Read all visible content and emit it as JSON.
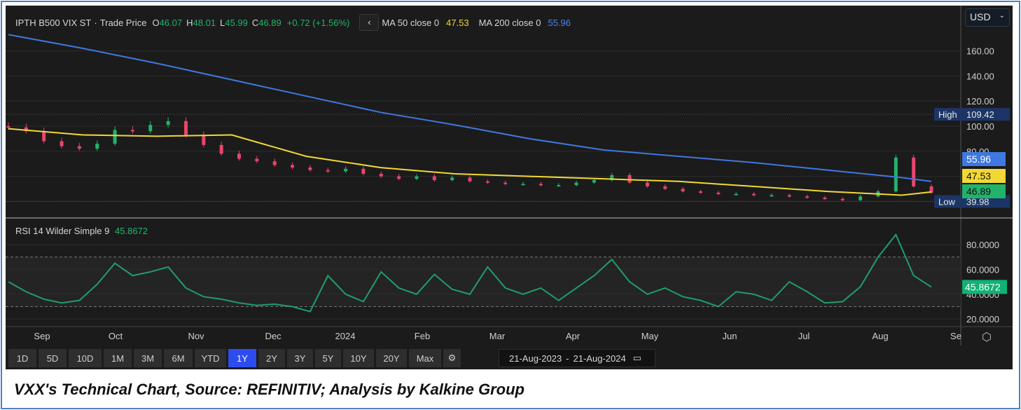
{
  "header": {
    "symbol": "IPTH B500 VIX ST",
    "separator": "·",
    "price_type": "Trade Price",
    "o_label": "O",
    "open": "46.07",
    "h_label": "H",
    "high": "48.01",
    "l_label": "L",
    "low": "45.99",
    "c_label": "C",
    "close": "46.89",
    "change": "+0.72 (+1.56%)",
    "back_icon": "chevron-left-icon",
    "ma50_label": "MA 50 close 0",
    "ma50_value": "47.53",
    "ma200_label": "MA 200 close 0",
    "ma200_value": "55.96"
  },
  "currency": {
    "selected": "USD"
  },
  "rsi_header": {
    "label": "RSI 14 Wilder Simple 9",
    "value": "45.8672"
  },
  "toolbar": {
    "buttons": [
      "1D",
      "5D",
      "10D",
      "1M",
      "3M",
      "6M",
      "YTD",
      "1Y",
      "2Y",
      "3Y",
      "5Y",
      "10Y",
      "20Y",
      "Max"
    ],
    "active": "1Y",
    "settings_icon": "gear-icon",
    "date_from": "21-Aug-2023",
    "date_sep": "-",
    "date_to": "21-Aug-2024",
    "calendar_icon": "calendar-icon"
  },
  "caption": "VXX's Technical Chart, Source: REFINITIV; Analysis by Kalkine Group",
  "colors": {
    "up": "#22b36b",
    "down": "#e8456a",
    "ma50": "#f2d835",
    "ma200": "#3f78e0",
    "rsi": "#1f9e6a",
    "background": "#1b1b1b"
  },
  "chart_data": [
    {
      "type": "candlestick",
      "title": "",
      "x_axis_ticks": [
        "Sep",
        "Oct",
        "Nov",
        "Dec",
        "2024",
        "Feb",
        "Mar",
        "Apr",
        "May",
        "Jun",
        "Jul",
        "Aug",
        "Se"
      ],
      "y_ticks": [
        "160.00",
        "140.00",
        "120.00",
        "100.00",
        "80.00"
      ],
      "ylim": [
        35,
        180
      ],
      "high_marker": {
        "label": "High",
        "value": "109.42"
      },
      "low_marker": {
        "label": "Low",
        "value": "39.98"
      },
      "last_labels": [
        "55.96",
        "47.53",
        "46.89"
      ],
      "dates_start": "21-Aug-2023",
      "dates_end": "21-Aug-2024",
      "interval": "weekly (approx.)",
      "close": [
        99,
        96,
        88,
        84,
        82,
        86,
        97,
        96,
        101,
        104,
        93,
        85,
        78,
        74,
        72,
        69,
        67,
        65,
        64,
        66,
        62,
        60,
        58,
        60,
        57,
        59,
        56,
        55,
        54,
        54,
        53,
        53,
        55,
        57,
        61,
        55,
        52,
        50,
        48,
        47,
        46,
        46,
        45,
        45,
        44,
        43,
        42,
        41,
        44,
        48,
        75,
        52,
        46.89
      ],
      "series": [
        {
          "name": "MA 200 close 0",
          "x_months": [
            "Aug",
            "Sep",
            "Oct",
            "Nov",
            "Dec",
            "Jan",
            "Feb",
            "Mar",
            "Apr",
            "May",
            "Jun",
            "Jul",
            "Aug",
            "Aug-21"
          ],
          "values": [
            173,
            162,
            150,
            137,
            124,
            111,
            101,
            90,
            81,
            76,
            71,
            65,
            59,
            55.96
          ]
        },
        {
          "name": "MA 50 close 0",
          "x_months": [
            "Aug",
            "Sep",
            "Oct",
            "Nov",
            "Dec",
            "Jan",
            "Feb",
            "Mar",
            "Apr",
            "May",
            "Jun",
            "Jul",
            "Aug",
            "Aug-21"
          ],
          "values": [
            98,
            93,
            92,
            93,
            76,
            67,
            62,
            60,
            58,
            56,
            52,
            48,
            45,
            47.53
          ]
        }
      ]
    },
    {
      "type": "line",
      "title": "RSI 14 Wilder Simple 9",
      "y_ticks": [
        "80.0000",
        "60.0000",
        "40.0000",
        "20.0000"
      ],
      "ylim": [
        15,
        95
      ],
      "bands": [
        30,
        70
      ],
      "series": [
        {
          "name": "RSI 14",
          "values": [
            50,
            42,
            36,
            33,
            35,
            48,
            65,
            55,
            58,
            62,
            45,
            38,
            36,
            33,
            31,
            32,
            30,
            26,
            55,
            40,
            34,
            58,
            45,
            40,
            56,
            44,
            40,
            62,
            45,
            40,
            45,
            35,
            45,
            55,
            68,
            50,
            40,
            45,
            38,
            35,
            30,
            42,
            40,
            35,
            50,
            42,
            33,
            34,
            46,
            70,
            88,
            55,
            45.8672
          ]
        }
      ],
      "last_label": "45.8672"
    }
  ]
}
